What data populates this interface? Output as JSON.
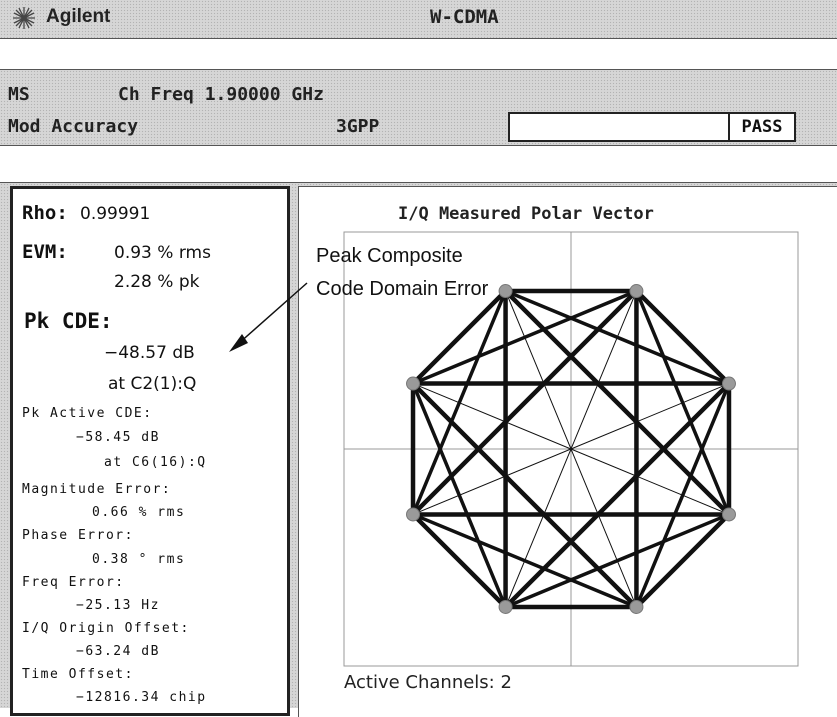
{
  "titlebar": {
    "brand": "Agilent",
    "screen_title": "W-CDMA",
    "logo_icon": "agilent-starburst-icon"
  },
  "header": {
    "line1_left": "MS",
    "line1_freq": "Ch Freq 1.90000 GHz",
    "line2_left": "Mod Accuracy",
    "line2_standard": "3GPP",
    "status": "PASS"
  },
  "results": {
    "rho_label": "Rho:",
    "rho_value": "0.99991",
    "evm_label": "EVM:",
    "evm_rms": "0.93 % rms",
    "evm_pk": "2.28 % pk",
    "pk_cde_label": "Pk CDE:",
    "pk_cde_value": "−48.57 dB",
    "pk_cde_at": "at C2(1):Q",
    "pk_active_cde_label": "Pk Active CDE:",
    "pk_active_cde_value": "−58.45 dB",
    "pk_active_cde_at": "at C6(16):Q",
    "magnitude_error_label": "Magnitude Error:",
    "magnitude_error_value": "0.66 % rms",
    "phase_error_label": "Phase Error:",
    "phase_error_value": "0.38 ° rms",
    "freq_error_label": "Freq Error:",
    "freq_error_value": "−25.13 Hz",
    "iq_origin_offset_label": "I/Q Origin Offset:",
    "iq_origin_offset_value": "−63.24 dB",
    "time_offset_label": "Time Offset:",
    "time_offset_value": "−12816.34 chip"
  },
  "plot": {
    "title": "I/Q Measured Polar Vector",
    "active_channels": "Active Channels: 2",
    "constellation_points": 8
  },
  "annotation": {
    "line1": "Peak Composite",
    "line2": "Code Domain Error"
  },
  "colors": {
    "screen_gray": "#d6d6d6",
    "trace": "#111111",
    "grid": "#999999",
    "marker": "#9a9a9a"
  }
}
